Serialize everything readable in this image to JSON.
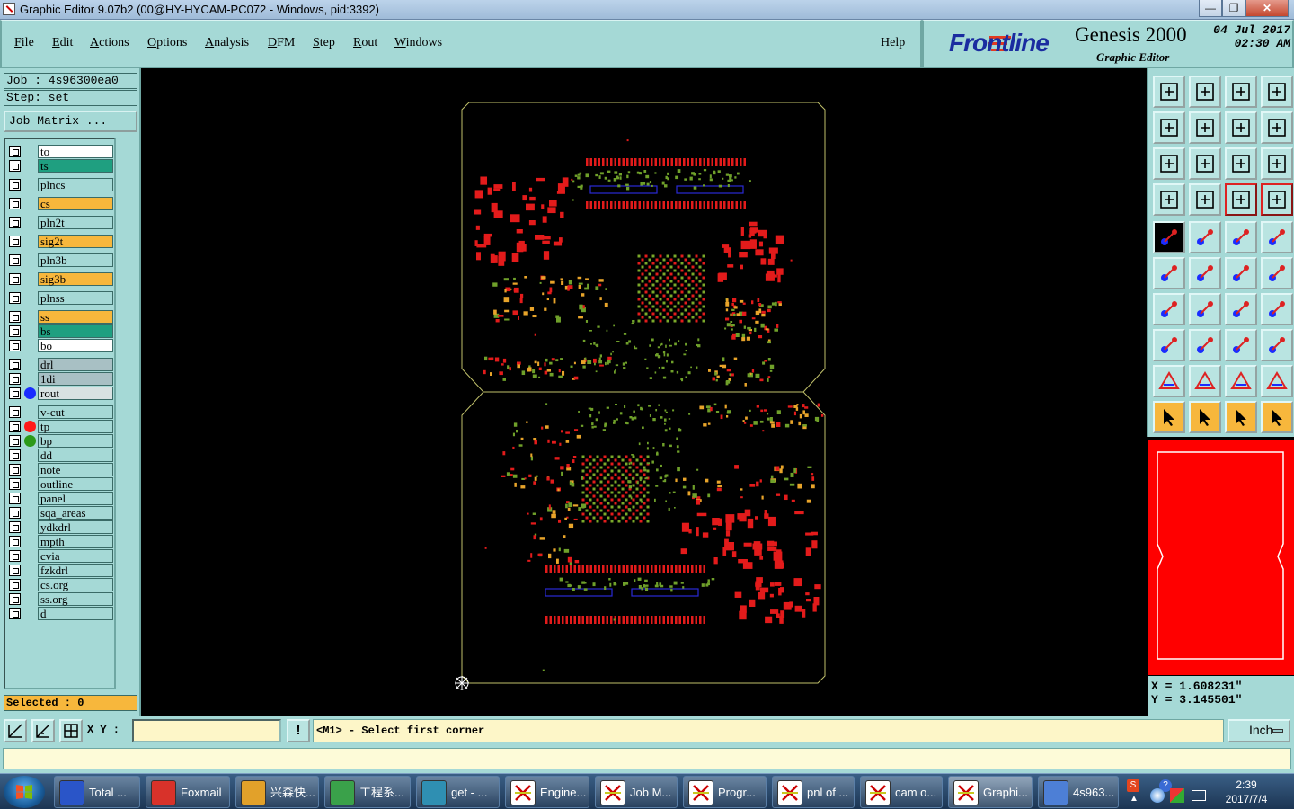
{
  "window": {
    "title": "Graphic Editor 9.07b2 (00@HY-HYCAM-PC072 - Windows, pid:3392)",
    "minimize": "—",
    "maximize": "❐",
    "close": "✕"
  },
  "menu": {
    "items": [
      {
        "label": "File",
        "underline": "F",
        "rest": "ile"
      },
      {
        "label": "Edit",
        "underline": "E",
        "rest": "dit"
      },
      {
        "label": "Actions",
        "underline": "A",
        "rest": "ctions"
      },
      {
        "label": "Options",
        "underline": "O",
        "rest": "ptions"
      },
      {
        "label": "Analysis",
        "underline": "A",
        "rest": "nalysis"
      },
      {
        "label": "DFM",
        "underline": "D",
        "rest": "FM"
      },
      {
        "label": "Step",
        "underline": "S",
        "rest": "tep"
      },
      {
        "label": "Rout",
        "underline": "R",
        "rest": "out"
      },
      {
        "label": "Windows",
        "underline": "W",
        "rest": "indows"
      }
    ],
    "help": "Help"
  },
  "brand": {
    "logo": "Frontline",
    "product": "Genesis 2000",
    "subtitle": "Graphic Editor",
    "date_line1": "04 Jul 2017",
    "date_line2": "02:30 AM"
  },
  "job": {
    "job_label": "Job : 4s96300ea0",
    "step_label": "Step: set",
    "matrix_button": "Job Matrix ..."
  },
  "layers": [
    {
      "name": "to",
      "color": "#ffffff"
    },
    {
      "name": "ts",
      "color": "#1f9f80"
    },
    {
      "name": "plncs",
      "color": "#a5d9d6"
    },
    {
      "name": "cs",
      "color": "#f7b73c"
    },
    {
      "name": "pln2t",
      "color": "#a5d9d6"
    },
    {
      "name": "sig2t",
      "color": "#f7b73c"
    },
    {
      "name": "pln3b",
      "color": "#a5d9d6"
    },
    {
      "name": "sig3b",
      "color": "#f7b73c"
    },
    {
      "name": "plnss",
      "color": "#a5d9d6"
    },
    {
      "name": "ss",
      "color": "#f7b73c"
    },
    {
      "name": "bs",
      "color": "#1f9f80"
    },
    {
      "name": "bo",
      "color": "#ffffff"
    },
    {
      "name": "drl",
      "color": "#a8c0c4"
    },
    {
      "name": "1di",
      "color": "#a8c0c4"
    },
    {
      "name": "rout",
      "color": "#d8e2e2",
      "dot": "#1a2cff"
    },
    {
      "name": "v-cut",
      "color": "#a5d9d6"
    },
    {
      "name": "tp",
      "color": "#a5d9d6",
      "dot": "#ff1a1a"
    },
    {
      "name": "bp",
      "color": "#a5d9d6",
      "dot": "#2c9a1a"
    },
    {
      "name": "dd",
      "color": "#a5d9d6"
    },
    {
      "name": "note",
      "color": "#a5d9d6"
    },
    {
      "name": "outline",
      "color": "#a5d9d6"
    },
    {
      "name": "panel",
      "color": "#a5d9d6"
    },
    {
      "name": "sqa_areas",
      "color": "#a5d9d6"
    },
    {
      "name": "ydkdrl",
      "color": "#a5d9d6"
    },
    {
      "name": "mpth",
      "color": "#a5d9d6"
    },
    {
      "name": "cvia",
      "color": "#a5d9d6"
    },
    {
      "name": "fzkdrl",
      "color": "#a5d9d6"
    },
    {
      "name": "cs.org",
      "color": "#a5d9d6"
    },
    {
      "name": "ss.org",
      "color": "#a5d9d6"
    },
    {
      "name": "d",
      "color": "#a5d9d6"
    }
  ],
  "selected": "Selected : 0",
  "coords": {
    "x": "X = 1.608231\"",
    "y": "Y = 3.145501\""
  },
  "status": {
    "xy_label": "X Y :",
    "xy_value": "",
    "message": "<M1> - Select first corner",
    "unit": "Inch",
    "alert": "!"
  },
  "taskbar": {
    "tasks": [
      {
        "label": "Total ...",
        "icon": "floppy-icon",
        "color": "#2a55c8"
      },
      {
        "label": "Foxmail",
        "icon": "foxmail-icon",
        "color": "#d8322a"
      },
      {
        "label": "兴森快...",
        "icon": "shell-icon",
        "color": "#e2a12a"
      },
      {
        "label": "工程系...",
        "icon": "pcb-icon",
        "color": "#3aa14a"
      },
      {
        "label": "get - ...",
        "icon": "eye-icon",
        "color": "#2f8fb2"
      },
      {
        "label": "Engine...",
        "icon": "genesis-icon",
        "color": "#ffffff"
      },
      {
        "label": "Job M...",
        "icon": "genesis-icon",
        "color": "#ffffff"
      },
      {
        "label": "Progr...",
        "icon": "genesis-icon",
        "color": "#ffffff"
      },
      {
        "label": "pnl of ...",
        "icon": "genesis-icon",
        "color": "#ffffff"
      },
      {
        "label": "cam o...",
        "icon": "genesis-icon",
        "color": "#ffffff"
      },
      {
        "label": "Graphi...",
        "icon": "genesis-icon",
        "color": "#ffffff"
      },
      {
        "label": "4s963...",
        "icon": "document-icon",
        "color": "#4d7fd6"
      }
    ],
    "time": "2:39",
    "date": "2017/7/4"
  }
}
